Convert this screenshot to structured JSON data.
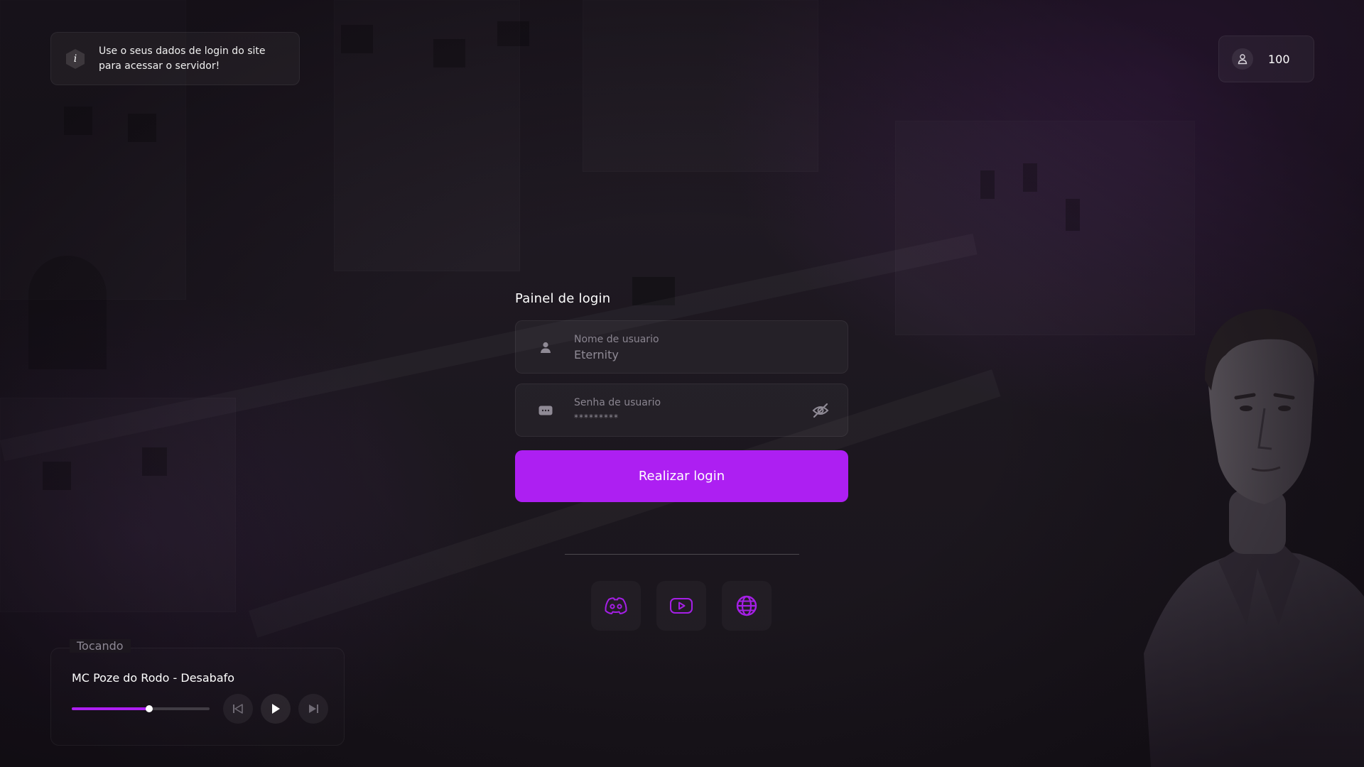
{
  "info_toast": {
    "badge_letter": "i",
    "message": "Use o seus dados de login do site para acessar o servidor!"
  },
  "players": {
    "icon": "user-icon",
    "count": "100"
  },
  "login": {
    "title": "Painel de login",
    "username": {
      "label": "Nome de usuario",
      "value": "Eternity",
      "icon": "user-icon"
    },
    "password": {
      "label": "Senha de usuario",
      "value": "*********",
      "icon": "password-dots-icon",
      "toggle_icon": "eye-off-icon"
    },
    "submit_label": "Realizar login"
  },
  "social_links": [
    {
      "name": "discord",
      "icon": "discord-icon"
    },
    {
      "name": "youtube",
      "icon": "youtube-icon"
    },
    {
      "name": "website",
      "icon": "globe-icon"
    }
  ],
  "music_player": {
    "legend": "Tocando",
    "track": "MC Poze do Rodo - Desabafo",
    "progress": 0.56,
    "controls": [
      "skip-previous-icon",
      "play-icon",
      "skip-next-icon"
    ]
  },
  "colors": {
    "accent": "#ad1ff2",
    "background": "#1b161e"
  }
}
